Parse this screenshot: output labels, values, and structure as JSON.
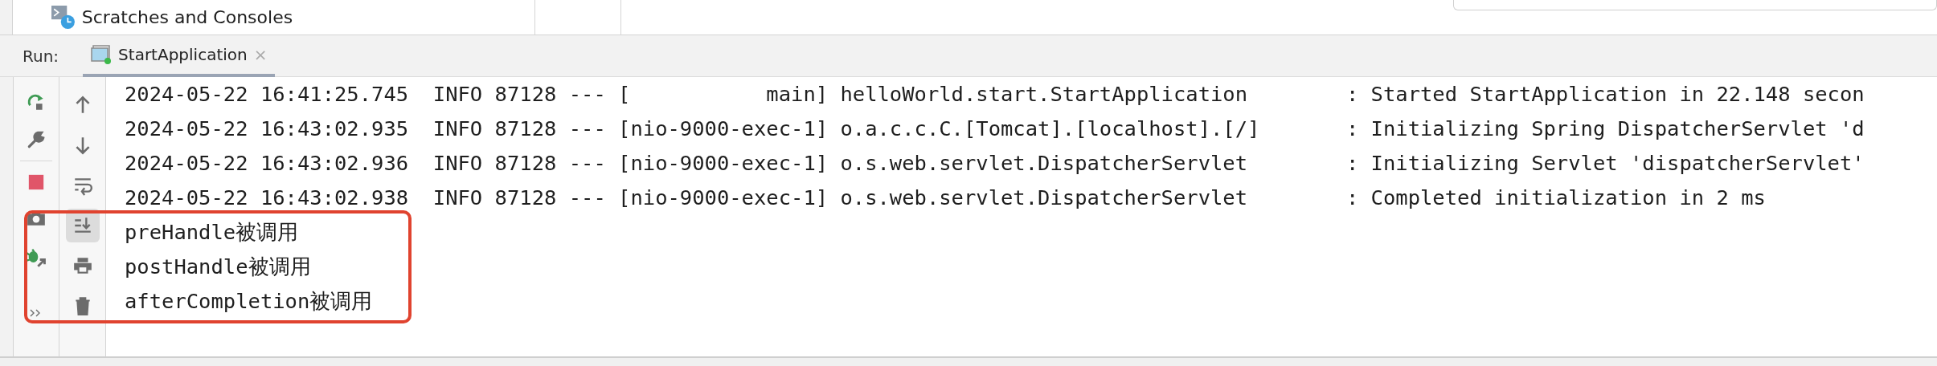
{
  "top_panel": {
    "item": {
      "label": "Scratches and Consoles"
    }
  },
  "run_bar": {
    "label": "Run:",
    "tabs": [
      {
        "label": "StartApplication",
        "selected": true,
        "close": "×"
      }
    ]
  },
  "left_toolbar": [
    {
      "kind": "rerun"
    },
    {
      "kind": "settings"
    },
    {
      "kind": "stop"
    },
    {
      "kind": "screenshot"
    },
    {
      "kind": "debug"
    },
    {
      "kind": "more"
    }
  ],
  "console_toolbar": [
    {
      "kind": "up",
      "on": false
    },
    {
      "kind": "down",
      "on": false
    },
    {
      "kind": "wrap",
      "on": false
    },
    {
      "kind": "scroll-end",
      "on": true
    },
    {
      "kind": "print",
      "on": false
    },
    {
      "kind": "clear",
      "on": false
    }
  ],
  "console": {
    "lines": [
      {
        "text": "2024-05-22 16:41:25.745  INFO 87128 --- [           main] helloWorld.start.StartApplication        : Started StartApplication in 22.148 secon",
        "highlighted": false
      },
      {
        "text": "2024-05-22 16:43:02.935  INFO 87128 --- [nio-9000-exec-1] o.a.c.c.C.[Tomcat].[localhost].[/]       : Initializing Spring DispatcherServlet 'd",
        "highlighted": false
      },
      {
        "text": "2024-05-22 16:43:02.936  INFO 87128 --- [nio-9000-exec-1] o.s.web.servlet.DispatcherServlet        : Initializing Servlet 'dispatcherServlet'",
        "highlighted": false
      },
      {
        "text": "2024-05-22 16:43:02.938  INFO 87128 --- [nio-9000-exec-1] o.s.web.servlet.DispatcherServlet        : Completed initialization in 2 ms",
        "highlighted": false
      },
      {
        "text": "preHandle被调用",
        "highlighted": true
      },
      {
        "text": "postHandle被调用",
        "highlighted": true
      },
      {
        "text": "afterCompletion被调用",
        "highlighted": true
      }
    ]
  }
}
